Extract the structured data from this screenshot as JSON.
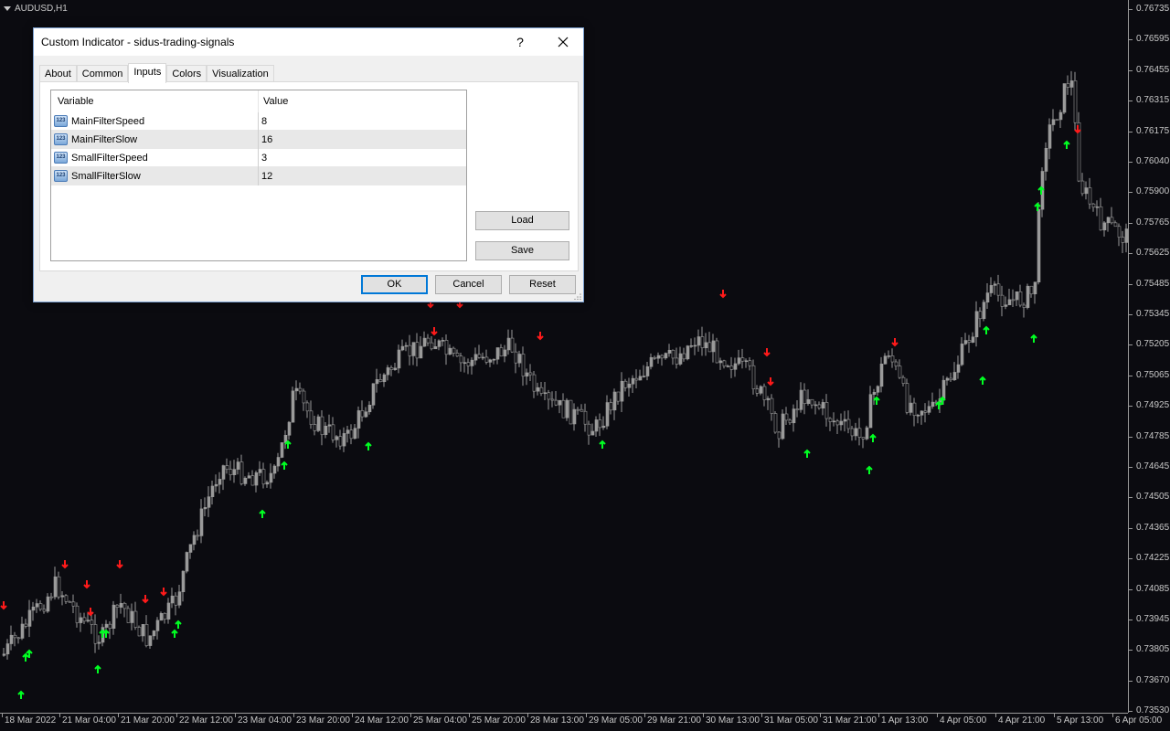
{
  "chart": {
    "symbol_label": "AUDUSD,H1",
    "background_color": "#0b0b10",
    "candle_color": "#9a9a9a",
    "buy_arrow_color": "#00ff22",
    "sell_arrow_color": "#ff1a1a",
    "price_ticks": [
      "0.76735",
      "0.76595",
      "0.76455",
      "0.76315",
      "0.76175",
      "0.76040",
      "0.75900",
      "0.75765",
      "0.75625",
      "0.75485",
      "0.75345",
      "0.75205",
      "0.75065",
      "0.74925",
      "0.74785",
      "0.74645",
      "0.74505",
      "0.74365",
      "0.74225",
      "0.74085",
      "0.73945",
      "0.73805",
      "0.73670",
      "0.73530"
    ],
    "time_ticks": [
      "18 Mar 2022",
      "21 Mar 04:00",
      "21 Mar 20:00",
      "22 Mar 12:00",
      "23 Mar 04:00",
      "23 Mar 20:00",
      "24 Mar 12:00",
      "25 Mar 04:00",
      "25 Mar 20:00",
      "28 Mar 13:00",
      "29 Mar 05:00",
      "29 Mar 21:00",
      "30 Mar 13:00",
      "31 Mar 05:00",
      "31 Mar 21:00",
      "1 Apr 13:00",
      "4 Apr 05:00",
      "4 Apr 21:00",
      "5 Apr 13:00",
      "6 Apr 05:00"
    ]
  },
  "dialog": {
    "title": "Custom Indicator - sidus-trading-signals",
    "help_label": "?",
    "tabs": [
      {
        "label": "About"
      },
      {
        "label": "Common"
      },
      {
        "label": "Inputs"
      },
      {
        "label": "Colors"
      },
      {
        "label": "Visualization"
      }
    ],
    "active_tab": "Inputs",
    "table": {
      "headers": {
        "variable": "Variable",
        "value": "Value"
      },
      "row_icon_text": "123",
      "rows": [
        {
          "variable": "MainFilterSpeed",
          "value": "8"
        },
        {
          "variable": "MainFilterSlow",
          "value": "16"
        },
        {
          "variable": "SmallFilterSpeed",
          "value": "3"
        },
        {
          "variable": "SmallFilterSlow",
          "value": "12"
        }
      ]
    },
    "buttons": {
      "load": "Load",
      "save": "Save",
      "ok": "OK",
      "cancel": "Cancel",
      "reset": "Reset"
    }
  }
}
